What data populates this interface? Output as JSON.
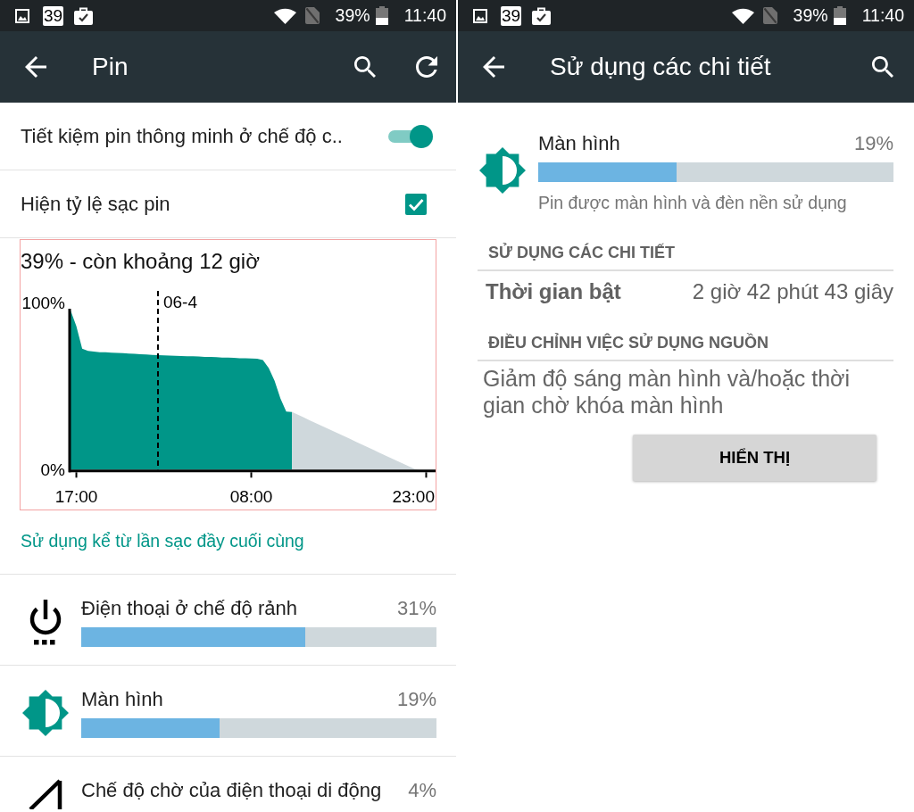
{
  "battery_screen": {
    "status_bar": {
      "calendar_date": "39",
      "battery_percent": "39%",
      "time": "11:40"
    },
    "app_bar": {
      "title": "Pin"
    },
    "settings": [
      {
        "kind": "switch",
        "label": "Tiết kiệm pin thông minh ở chế độ c..",
        "checked": true
      },
      {
        "kind": "checkbox",
        "label": "Hiện tỷ lệ sạc pin",
        "checked": true
      }
    ],
    "history": {
      "chart_data": {
        "type": "area",
        "title": "39% - còn khoảng 12 giờ",
        "categories": [
          null,
          "17:00",
          null,
          null,
          null,
          null,
          null,
          null,
          null,
          null,
          null,
          null,
          null,
          null,
          null,
          null,
          null,
          null,
          null,
          null,
          null,
          null,
          null,
          null,
          null,
          null,
          null,
          null,
          null,
          null,
          null,
          "08:00",
          null,
          null,
          null,
          null,
          null,
          null,
          null,
          null,
          null,
          null,
          null,
          null,
          null,
          null,
          null,
          null,
          null,
          null,
          null,
          null,
          null,
          null,
          null,
          null,
          null,
          null,
          null,
          null,
          null,
          "23:00",
          null
        ],
        "series": [
          {
            "color": "#009688",
            "values": [
              95.5,
              86,
              72.5,
              71.1,
              70.7,
              70.4,
              70.3,
              70.1,
              69.9,
              69.8,
              69.6,
              69.4,
              69.2,
              69,
              68.8,
              68.6,
              68.5,
              68.4,
              68.2,
              68.1,
              68,
              67.9,
              67.8,
              67.6,
              67.5,
              67.4,
              67.2,
              67.1,
              67,
              66.8,
              66.7,
              66.6,
              66.5,
              65.7,
              60.9,
              53.3,
              42.7,
              34.8,
              34.5,
              null,
              null,
              null,
              null,
              null,
              null,
              null,
              null,
              null,
              null,
              null,
              null,
              null,
              null,
              null,
              null,
              null,
              null,
              null,
              null,
              null,
              null,
              null,
              null
            ]
          },
          {
            "color": "#cfd8dc",
            "values": [
              null,
              null,
              null,
              null,
              null,
              null,
              null,
              null,
              null,
              null,
              null,
              null,
              null,
              null,
              null,
              null,
              null,
              null,
              null,
              null,
              null,
              null,
              null,
              null,
              null,
              null,
              null,
              null,
              null,
              null,
              null,
              null,
              null,
              null,
              null,
              null,
              null,
              null,
              34.5,
              32.9,
              31.3,
              29.6,
              28,
              26.4,
              24.8,
              23.1,
              21.5,
              19.9,
              18.3,
              16.6,
              15,
              13.4,
              11.8,
              10.1,
              8.5,
              6.9,
              5.3,
              3.6,
              2,
              0.4,
              0,
              null,
              null
            ]
          }
        ],
        "ylim": [
          0,
          100
        ],
        "yticks": [
          {
            "value": 0,
            "label": "0%"
          },
          {
            "value": 100,
            "label": "100%"
          }
        ],
        "annotations": [
          "06-4"
        ]
      }
    },
    "category_title": "Sử dụng kể từ lần sạc đầy cuối cùng",
    "usage_items": [
      {
        "kind": "idle",
        "name": "Điện thoại ở chế độ rảnh",
        "percent": "31%",
        "level": 0.63
      },
      {
        "kind": "screen",
        "name": "Màn hình",
        "percent": "19%",
        "level": 0.39
      },
      {
        "kind": "cell_standby",
        "name": "Chế độ chờ của điện thoại di động",
        "percent": "4%"
      }
    ]
  },
  "details_screen": {
    "status_bar": {
      "calendar_date": "39",
      "battery_percent": "39%",
      "time": "11:40"
    },
    "app_bar": {
      "title": "Sử dụng các chi tiết"
    },
    "app": {
      "kind": "screen",
      "name": "Màn hình",
      "percent": "19%",
      "level": 0.39,
      "description": "Pin được màn hình và đèn nền sử dụng"
    },
    "sections": [
      {
        "title": "SỬ DỤNG CÁC CHI TIẾT",
        "rows": [
          {
            "label": "Thời gian bật",
            "value": "2 giờ 42 phút 43 giây"
          }
        ]
      },
      {
        "title": "ĐIỀU CHỈNH VIỆC SỬ DỤNG NGUỒN",
        "text": "Giảm độ sáng màn hình và/hoặc thời gian chờ khóa màn hình",
        "button": "HIỂN THỊ"
      }
    ]
  }
}
